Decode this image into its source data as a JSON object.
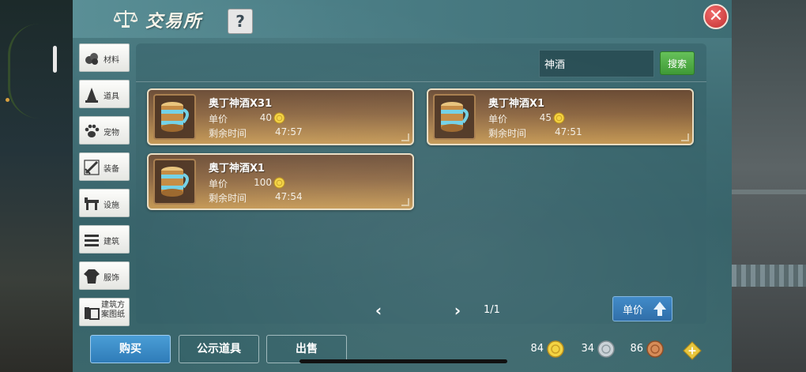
{
  "window": {
    "title": "交易所",
    "help_label": "?",
    "close_label": "✕"
  },
  "sidebar": {
    "items": [
      {
        "label": "材料",
        "icon": "material-icon"
      },
      {
        "label": "道具",
        "icon": "item-icon"
      },
      {
        "label": "宠物",
        "icon": "pet-paw-icon"
      },
      {
        "label": "装备",
        "icon": "equipment-sword-icon"
      },
      {
        "label": "设施",
        "icon": "facility-icon"
      },
      {
        "label": "建筑",
        "icon": "building-icon"
      },
      {
        "label": "服饰",
        "icon": "clothing-icon"
      },
      {
        "label": "建筑方案图纸",
        "icon": "blueprint-icon"
      }
    ]
  },
  "search": {
    "value": "神酒",
    "button_label": "搜索"
  },
  "labels": {
    "price": "单价",
    "time": "剩余时间"
  },
  "listings": [
    {
      "name": "奥丁神酒X31",
      "price": "40",
      "time": "47:57"
    },
    {
      "name": "奥丁神酒X1",
      "price": "45",
      "time": "47:51"
    },
    {
      "name": "奥丁神酒X1",
      "price": "100",
      "time": "47:54"
    }
  ],
  "pager": {
    "label": "1/1",
    "prev": "‹",
    "next": "›"
  },
  "sort": {
    "label": "单价",
    "icon": "sort-up-arrow-icon"
  },
  "bottom": {
    "buy_label": "购买",
    "public_label": "公示道具",
    "sell_label": "出售",
    "add_label": "+"
  },
  "currencies": [
    {
      "value": "84",
      "icon": "gold-coin-icon",
      "color": "#e9c22e"
    },
    {
      "value": "34",
      "icon": "silver-coin-icon",
      "color": "#b9c3c9"
    },
    {
      "value": "86",
      "icon": "copper-coin-icon",
      "color": "#c77a46"
    }
  ],
  "colors": {
    "accent_blue": "#2f7cb8",
    "search_green": "#3f9a36",
    "close_red": "#c23030",
    "card_brown": "#8b6540"
  }
}
